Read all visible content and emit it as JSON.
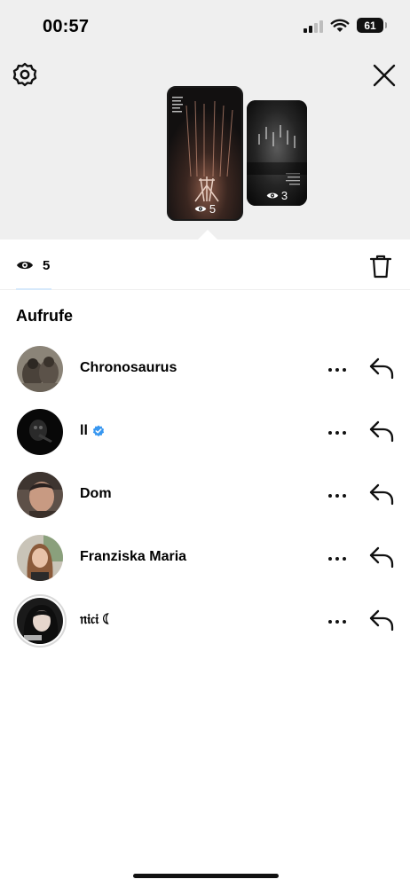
{
  "status_bar": {
    "time": "00:57",
    "battery": "61"
  },
  "thumbnails": [
    {
      "views": "5"
    },
    {
      "views": "3"
    }
  ],
  "views_header": {
    "count": "5"
  },
  "section_title": "Aufrufe",
  "viewers": [
    {
      "name": "Chronosaurus",
      "verified": false
    },
    {
      "name": "ll",
      "verified": true
    },
    {
      "name": "Dom",
      "verified": false
    },
    {
      "name": "Franziska Maria",
      "verified": false
    },
    {
      "name": "𝔫𝔦𝔠𝔦 ☾",
      "verified": false
    }
  ],
  "colors": {
    "verified": "#3897f0",
    "top_background": "#efefef"
  },
  "icons": [
    "gear-icon",
    "close-icon",
    "eye-icon",
    "trash-icon",
    "more-icon",
    "reply-icon",
    "verified-icon"
  ]
}
